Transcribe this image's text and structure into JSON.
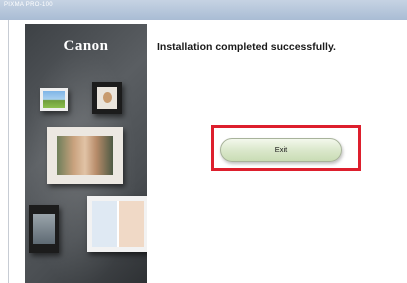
{
  "window": {
    "title": "PIXMA PRO-100"
  },
  "side_panel": {
    "brand": "Canon"
  },
  "main": {
    "message": "Installation completed successfully.",
    "exit_label": "Exit"
  },
  "colors": {
    "highlight": "#dd1f2d",
    "button_bg": "#dbe8cc"
  }
}
